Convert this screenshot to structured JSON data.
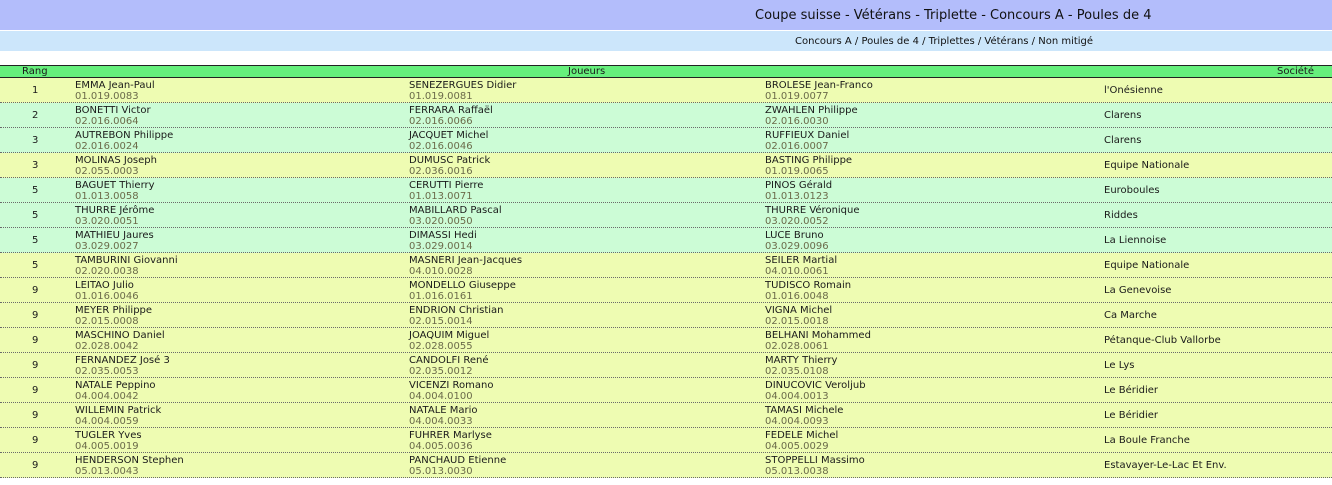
{
  "header": {
    "title": "Coupe suisse - Vétérans - Triplette - Concours A - Poules de 4",
    "breadcrumb": "Concours A / Poules de 4 / Triplettes / Vétérans / Non mitigé"
  },
  "table": {
    "columns": {
      "rank": "Rang",
      "players": "Joueurs",
      "club": "Société"
    },
    "colors": {
      "header": "#66ef7c",
      "row_yellow": "#eefcb2",
      "row_green": "#ccfcd6"
    },
    "rows": [
      {
        "rank": "1",
        "color": "yellow",
        "players": [
          {
            "name": "EMMA Jean-Paul",
            "license": "01.019.0083"
          },
          {
            "name": "SENEZERGUES Didier",
            "license": "01.019.0081"
          },
          {
            "name": "BROLESE Jean-Franco",
            "license": "01.019.0077"
          }
        ],
        "club": "l'Onésienne"
      },
      {
        "rank": "2",
        "color": "green",
        "players": [
          {
            "name": "BONETTI Victor",
            "license": "02.016.0064"
          },
          {
            "name": "FERRARA Raffaël",
            "license": "02.016.0066"
          },
          {
            "name": "ZWAHLEN Philippe",
            "license": "02.016.0030"
          }
        ],
        "club": "Clarens"
      },
      {
        "rank": "3",
        "color": "green",
        "players": [
          {
            "name": "AUTREBON Philippe",
            "license": "02.016.0024"
          },
          {
            "name": "JACQUET Michel",
            "license": "02.016.0046"
          },
          {
            "name": "RUFFIEUX Daniel",
            "license": "02.016.0007"
          }
        ],
        "club": "Clarens"
      },
      {
        "rank": "3",
        "color": "yellow",
        "players": [
          {
            "name": "MOLINAS Joseph",
            "license": "02.055.0003"
          },
          {
            "name": "DUMUSC Patrick",
            "license": "02.036.0016"
          },
          {
            "name": "BASTING Philippe",
            "license": "01.019.0065"
          }
        ],
        "club": "Equipe Nationale"
      },
      {
        "rank": "5",
        "color": "green",
        "players": [
          {
            "name": "BAGUET Thierry",
            "license": "01.013.0058"
          },
          {
            "name": "CERUTTI Pierre",
            "license": "01.013.0071"
          },
          {
            "name": "PINOS Gérald",
            "license": "01.013.0123"
          }
        ],
        "club": "Euroboules"
      },
      {
        "rank": "5",
        "color": "green",
        "players": [
          {
            "name": "THURRE Jérôme",
            "license": "03.020.0051"
          },
          {
            "name": "MABILLARD Pascal",
            "license": "03.020.0050"
          },
          {
            "name": "THURRE Véronique",
            "license": "03.020.0052"
          }
        ],
        "club": "Riddes"
      },
      {
        "rank": "5",
        "color": "green",
        "players": [
          {
            "name": "MATHIEU Jaures",
            "license": "03.029.0027"
          },
          {
            "name": "DIMASSI Hedi",
            "license": "03.029.0014"
          },
          {
            "name": "LUCE Bruno",
            "license": "03.029.0096"
          }
        ],
        "club": "La Liennoise"
      },
      {
        "rank": "5",
        "color": "yellow",
        "players": [
          {
            "name": "TAMBURINI Giovanni",
            "license": "02.020.0038"
          },
          {
            "name": "MASNERI Jean-Jacques",
            "license": "04.010.0028"
          },
          {
            "name": "SEILER Martial",
            "license": "04.010.0061"
          }
        ],
        "club": "Equipe Nationale"
      },
      {
        "rank": "9",
        "color": "yellow",
        "players": [
          {
            "name": "LEITAO Julio",
            "license": "01.016.0046"
          },
          {
            "name": "MONDELLO Giuseppe",
            "license": "01.016.0161"
          },
          {
            "name": "TUDISCO Romain",
            "license": "01.016.0048"
          }
        ],
        "club": "La Genevoise"
      },
      {
        "rank": "9",
        "color": "yellow",
        "players": [
          {
            "name": "MEYER Philippe",
            "license": "02.015.0008"
          },
          {
            "name": "ENDRION Christian",
            "license": "02.015.0014"
          },
          {
            "name": "VIGNA Michel",
            "license": "02.015.0018"
          }
        ],
        "club": "Ca Marche"
      },
      {
        "rank": "9",
        "color": "yellow",
        "players": [
          {
            "name": "MASCHINO Daniel",
            "license": "02.028.0042"
          },
          {
            "name": "JOAQUIM Miguel",
            "license": "02.028.0055"
          },
          {
            "name": "BELHANI Mohammed",
            "license": "02.028.0061"
          }
        ],
        "club": "Pétanque-Club Vallorbe"
      },
      {
        "rank": "9",
        "color": "yellow",
        "players": [
          {
            "name": "FERNANDEZ José 3",
            "license": "02.035.0053"
          },
          {
            "name": "CANDOLFI René",
            "license": "02.035.0012"
          },
          {
            "name": "MARTY Thierry",
            "license": "02.035.0108"
          }
        ],
        "club": "Le Lys"
      },
      {
        "rank": "9",
        "color": "yellow",
        "players": [
          {
            "name": "NATALE Peppino",
            "license": "04.004.0042"
          },
          {
            "name": "VICENZI Romano",
            "license": "04.004.0100"
          },
          {
            "name": "DINUCOVIC Veroljub",
            "license": "04.004.0013"
          }
        ],
        "club": "Le Béridier"
      },
      {
        "rank": "9",
        "color": "yellow",
        "players": [
          {
            "name": "WILLEMIN Patrick",
            "license": "04.004.0059"
          },
          {
            "name": "NATALE Mario",
            "license": "04.004.0033"
          },
          {
            "name": "TAMASI Michele",
            "license": "04.004.0093"
          }
        ],
        "club": "Le Béridier"
      },
      {
        "rank": "9",
        "color": "yellow",
        "players": [
          {
            "name": "TUGLER Yves",
            "license": "04.005.0019"
          },
          {
            "name": "FUHRER Marlyse",
            "license": "04.005.0036"
          },
          {
            "name": "FEDELE Michel",
            "license": "04.005.0029"
          }
        ],
        "club": "La Boule Franche"
      },
      {
        "rank": "9",
        "color": "yellow",
        "players": [
          {
            "name": "HENDERSON Stephen",
            "license": "05.013.0043"
          },
          {
            "name": "PANCHAUD Etienne",
            "license": "05.013.0030"
          },
          {
            "name": "STOPPELLI Massimo",
            "license": "05.013.0038"
          }
        ],
        "club": "Estavayer-Le-Lac Et Env."
      }
    ]
  }
}
